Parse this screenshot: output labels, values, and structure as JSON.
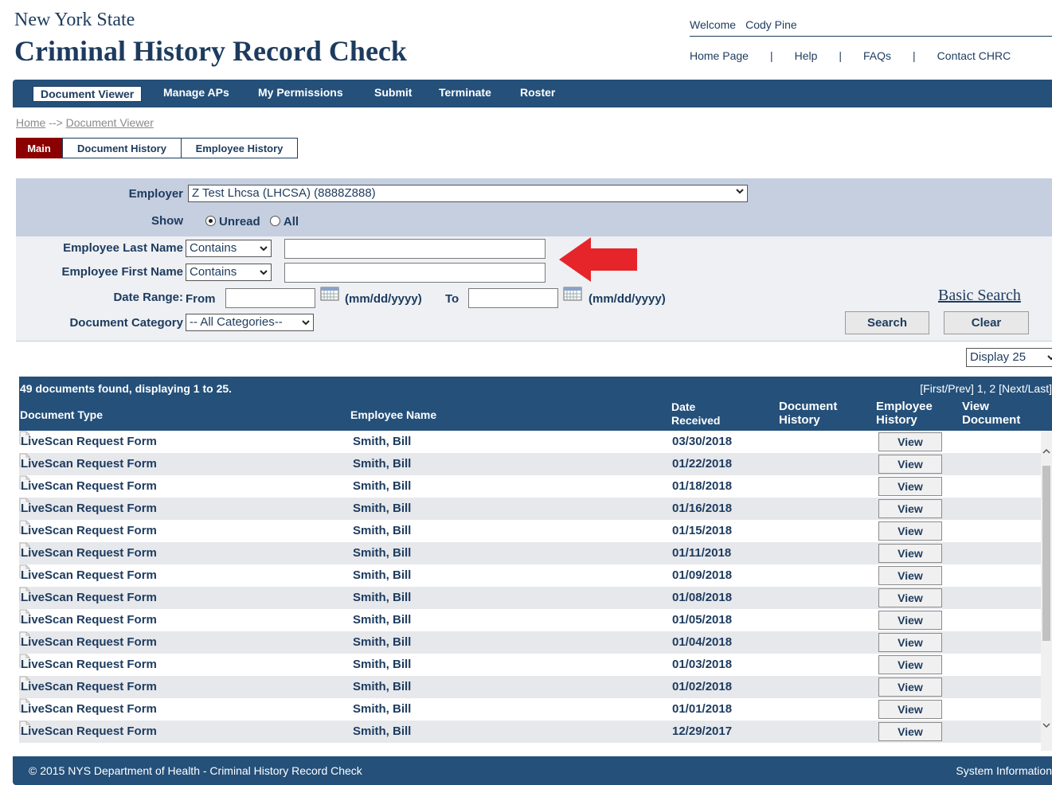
{
  "header": {
    "state": "New York State",
    "title": "Criminal History Record Check",
    "welcome_label": "Welcome",
    "user": "Cody Pine",
    "links": [
      "Home Page",
      "Help",
      "FAQs",
      "Contact CHRC"
    ]
  },
  "nav": {
    "items": [
      "Document Viewer",
      "Manage APs",
      "My Permissions",
      "Submit",
      "Terminate",
      "Roster"
    ],
    "active": "Document Viewer"
  },
  "breadcrumb": {
    "home": "Home",
    "sep": "-->",
    "current": "Document Viewer"
  },
  "subtabs": [
    "Main",
    "Document History",
    "Employee History"
  ],
  "search": {
    "employer_label": "Employer",
    "employer_value": "Z Test Lhcsa (LHCSA) (8888Z888)",
    "show_label": "Show",
    "show_options": [
      "Unread",
      "All"
    ],
    "show_selected": "Unread",
    "last_name_label": "Employee Last Name",
    "first_name_label": "Employee First Name",
    "match_value": "Contains",
    "date_range_label": "Date Range:",
    "from_label": "From",
    "to_label": "To",
    "date_format": "(mm/dd/yyyy)",
    "category_label": "Document Category",
    "category_value": "-- All Categories--",
    "basic_search": "Basic Search",
    "search_btn": "Search",
    "clear_btn": "Clear"
  },
  "display_select": "Display 25",
  "results": {
    "summary": "49 documents found, displaying 1 to 25.",
    "pager": "[First/Prev] 1, 2 [Next/Last]",
    "columns": {
      "doc_type": "Document Type",
      "emp_name": "Employee Name",
      "date1": "Date",
      "date2": "Received",
      "dh1": "Document",
      "dh2": "History",
      "eh1": "Employee",
      "eh2": "History",
      "vd1": "View",
      "vd2": "Document"
    },
    "view_label": "View",
    "rows": [
      {
        "type": "LiveScan Request Form",
        "name": "Smith, Bill",
        "date": "03/30/2018"
      },
      {
        "type": "LiveScan Request Form",
        "name": "Smith, Bill",
        "date": "01/22/2018"
      },
      {
        "type": "LiveScan Request Form",
        "name": "Smith, Bill",
        "date": "01/18/2018"
      },
      {
        "type": "LiveScan Request Form",
        "name": "Smith, Bill",
        "date": "01/16/2018"
      },
      {
        "type": "LiveScan Request Form",
        "name": "Smith, Bill",
        "date": "01/15/2018"
      },
      {
        "type": "LiveScan Request Form",
        "name": "Smith, Bill",
        "date": "01/11/2018"
      },
      {
        "type": "LiveScan Request Form",
        "name": "Smith, Bill",
        "date": "01/09/2018"
      },
      {
        "type": "LiveScan Request Form",
        "name": "Smith, Bill",
        "date": "01/08/2018"
      },
      {
        "type": "LiveScan Request Form",
        "name": "Smith, Bill",
        "date": "01/05/2018"
      },
      {
        "type": "LiveScan Request Form",
        "name": "Smith, Bill",
        "date": "01/04/2018"
      },
      {
        "type": "LiveScan Request Form",
        "name": "Smith, Bill",
        "date": "01/03/2018"
      },
      {
        "type": "LiveScan Request Form",
        "name": "Smith, Bill",
        "date": "01/02/2018"
      },
      {
        "type": "LiveScan Request Form",
        "name": "Smith, Bill",
        "date": "01/01/2018"
      },
      {
        "type": "LiveScan Request Form",
        "name": "Smith, Bill",
        "date": "12/29/2017"
      }
    ]
  },
  "footer": {
    "copyright": "© 2015 NYS Department of Health - Criminal History Record Check",
    "system_info": "System Information"
  },
  "colors": {
    "brand_blue": "#24507a",
    "active_tab": "#8b0000",
    "arrow": "#e5252a"
  }
}
